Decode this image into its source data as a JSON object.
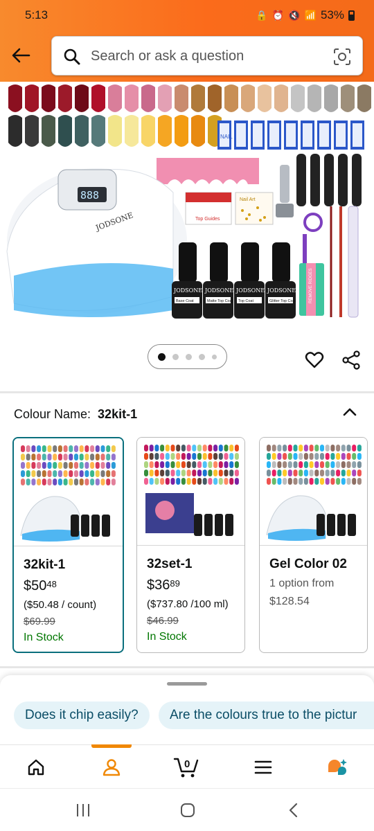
{
  "status_bar": {
    "time": "5:13",
    "battery": "53%"
  },
  "header": {
    "search_placeholder": "Search or ask a question"
  },
  "product_image": {
    "brand": "JODSONE",
    "lamp_display": "888",
    "bottles": [
      "Base Coat",
      "Matte Top Coat",
      "Top Coat",
      "Glitter Top Coat"
    ],
    "file_text": "NAIL",
    "buffer_text": "REMOVE RIDGES",
    "sticker_text": "Top Guides",
    "nail_art_text": "Nail Art"
  },
  "carousel": {
    "total": 5,
    "active": 1
  },
  "colour": {
    "label": "Colour Name:",
    "selected": "32kit-1",
    "options": [
      {
        "name": "32kit-1",
        "price_whole": "$50",
        "price_frac": "48",
        "unit_price": "($50.48 / count)",
        "was": "$69.99",
        "stock": "In Stock"
      },
      {
        "name": "32set-1",
        "price_whole": "$36",
        "price_frac": "89",
        "unit_price": "($737.80 /100 ml)",
        "was": "$46.99",
        "stock": "In Stock"
      },
      {
        "name": "Gel Color 02",
        "option_text": "1 option from",
        "from_price": "$128.54"
      }
    ]
  },
  "questions": [
    "Does it chip easily?",
    "Are the colours true to the pictur"
  ],
  "bottom_nav": [
    "home",
    "account",
    "cart",
    "menu",
    "rufus"
  ],
  "cart_count": "0",
  "colors": {
    "accent_orange": "#f88a2d",
    "selected_border": "#0a6f7d",
    "in_stock": "#007600",
    "chip_bg": "#e5f3f8"
  }
}
